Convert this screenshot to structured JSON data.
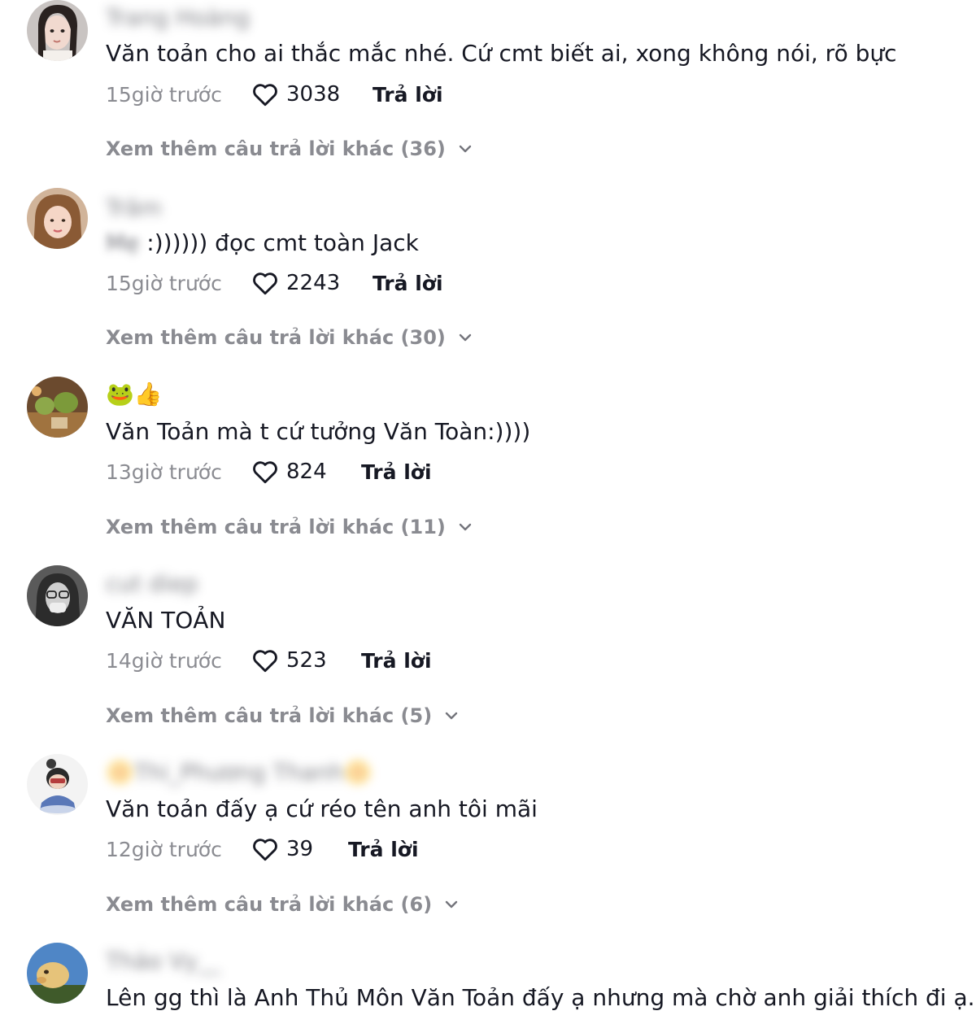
{
  "comments": [
    {
      "username": "Trang Hoàng",
      "text": "Văn toản cho ai thắc mắc nhé. Cứ cmt biết ai, xong không nói, rõ bực",
      "time": "15giờ trước",
      "likes": "3038",
      "reply_label": "Trả lời",
      "more_replies": "Xem thêm câu trả lời khác (36)"
    },
    {
      "username": "Trâm",
      "text_prefix": "Mẹ",
      "text": " :)))))) đọc cmt toàn Jack",
      "time": "15giờ trước",
      "likes": "2243",
      "reply_label": "Trả lời",
      "more_replies": "Xem thêm câu trả lời khác (30)"
    },
    {
      "username": "🐸👍",
      "text": "Văn Toản mà t cứ tưởng Văn Toàn:))))",
      "time": "13giờ trước",
      "likes": "824",
      "reply_label": "Trả lời",
      "more_replies": "Xem thêm câu trả lời khác (11)"
    },
    {
      "username": "cut diep",
      "text": "VĂN TOẢN",
      "time": "14giờ trước",
      "likes": "523",
      "reply_label": "Trả lời",
      "more_replies": "Xem thêm câu trả lời khác (5)"
    },
    {
      "username": "🌼Thi_Phương Thanh🌼",
      "text": "Văn toản đấy ạ cứ réo tên anh tôi mãi",
      "time": "12giờ trước",
      "likes": "39",
      "reply_label": "Trả lời",
      "more_replies": "Xem thêm câu trả lời khác (6)"
    },
    {
      "username": "Thảo Vy__",
      "text": "Lên gg thì là Anh Thủ Môn Văn Toản đấy ạ nhưng mà chờ anh giải thích đi ạ..."
    }
  ],
  "colors": {
    "text_primary": "#161823",
    "text_secondary": "rgba(22,24,35,0.5)"
  },
  "icons": {
    "like": "heart-outline-icon",
    "expand": "chevron-down-icon"
  }
}
